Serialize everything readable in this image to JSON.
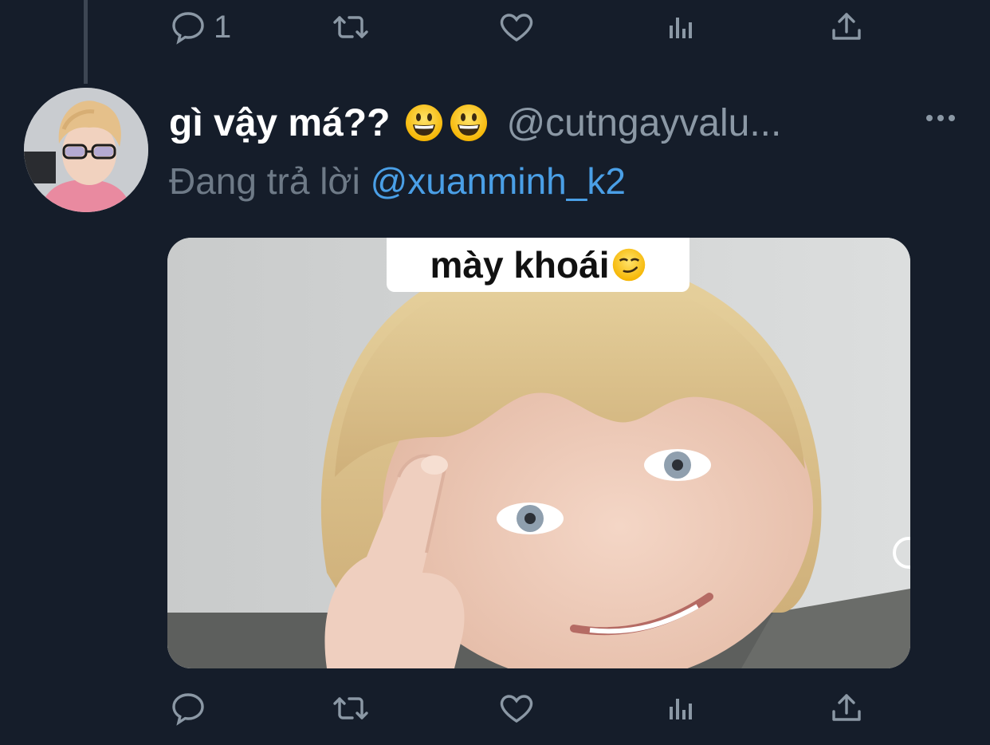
{
  "top_actions": {
    "reply_count": "1"
  },
  "tweet": {
    "display_name": "gì vậy má??",
    "display_name_emojis": [
      "grinning-face-emoji",
      "grinning-face-emoji"
    ],
    "handle": "@cutngayvalu...",
    "reply_prefix": "Đang trả lời",
    "reply_mention": "@xuanminh_k2",
    "media": {
      "caption": "mày khoái",
      "caption_emoji": "smirking-face-emoji"
    }
  },
  "bottom_actions": {
    "reply_count": ""
  },
  "colors": {
    "background": "#151d2a",
    "muted": "#8b98a5",
    "link": "#4a9fe6",
    "thread_line": "#3d4653"
  }
}
